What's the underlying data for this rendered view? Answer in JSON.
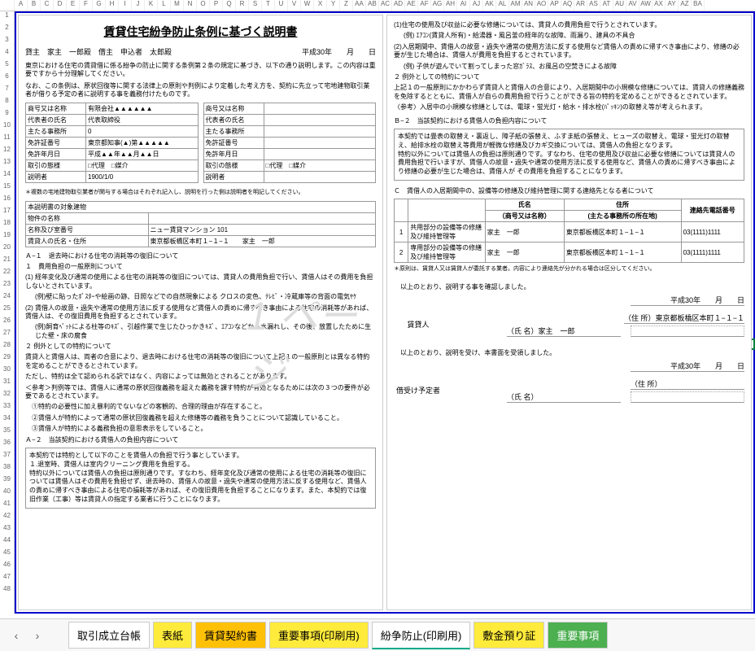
{
  "col_letters": [
    "A",
    "B",
    "C",
    "D",
    "E",
    "F",
    "G",
    "H",
    "I",
    "J",
    "K",
    "L",
    "M",
    "N",
    "O",
    "P",
    "Q",
    "R",
    "S",
    "T",
    "U",
    "V",
    "W",
    "X",
    "Y",
    "Z",
    "AA",
    "AB",
    "AC",
    "AD",
    "AE",
    "AF",
    "AG",
    "AH",
    "AI",
    "AJ",
    "AK",
    "AL",
    "AM",
    "AN",
    "AO",
    "AP",
    "AQ",
    "AR",
    "AS",
    "AT",
    "AU",
    "AV",
    "AW",
    "AX",
    "AY",
    "AZ",
    "BA"
  ],
  "title": "賃貸住宅紛争防止条例に基づく説明書",
  "header": {
    "lessor": "貸主　家主　一郎殿　借主　申込者　太郎殿",
    "date": "平成30年　　月　　日"
  },
  "intro": [
    "東京における住宅の賃貸借に係る紛争の防止に関する条例第２条の規定に基づき、以下の通り説明します。この内容は重要ですから十分理解してください。",
    "なお、この条例は、原状回復等に関する法律上の原則や判例により定着した考え方を、契約に先立って宅地建物取引業者が借りる予定の者に説明する事を義務付けたものです。"
  ],
  "reg_left": {
    "r1": {
      "l": "商号又は名称",
      "v": "有限会社▲▲▲▲▲▲"
    },
    "r2": {
      "l": "代表者の氏名",
      "v": "代表取締役"
    },
    "r3": {
      "l": "主たる事務所",
      "v": "0"
    },
    "r4": {
      "l": "免許証番号",
      "v": "東京都知事(▲)第▲▲▲▲▲"
    },
    "r5": {
      "l": "免許年月日",
      "v": "平成▲▲年▲▲月▲▲日"
    },
    "r6": {
      "l": "取引の態様",
      "v": "□代理　□媒介"
    },
    "r7": {
      "l": "説明者",
      "v": "1900/1/0"
    }
  },
  "reg_right": {
    "r1": {
      "l": "商号又は名称",
      "v": ""
    },
    "r2": {
      "l": "代表者の氏名",
      "v": ""
    },
    "r3": {
      "l": "主たる事務所",
      "v": ""
    },
    "r4": {
      "l": "免許証番号",
      "v": ""
    },
    "r5": {
      "l": "免許年月日",
      "v": ""
    },
    "r6": {
      "l": "取引の態様",
      "v": "□代理　□媒介"
    },
    "r7": {
      "l": "説明者",
      "v": ""
    }
  },
  "note1": "＊複数の宅地建物取引業者が関与する場合はそれぞれ記入し、説明を行った側は説明者を明記してください。",
  "prop": {
    "h": "本説明書の対象建物",
    "r1": {
      "l": "物件の名称",
      "v": ""
    },
    "r2": {
      "l": "名称及び室番号",
      "v": "ニュー賃貸マンション 101"
    },
    "r3": {
      "l": "賃貸人の氏名・住所",
      "v": "東京都板橋区本町１−１−１　　家主　一郎"
    }
  },
  "secA": {
    "h1": "Ａ−１　退去時における住宅の消耗等の復旧について",
    "h2": "１　費用負担の一般原則について",
    "p1": "(1) 経年変化及び通常の使用による住宅の消耗等の復旧については、賃貸人の費用負担で行い、賃借人はその費用を負担しないとされています。",
    "p2": "(例)壁に貼ったﾎﾟｽﾀｰや絵画の跡、日照などでの自然現象による クロスの変色、ﾃﾚﾋﾞ・冷蔵庫等の背面の電気ﾔｹ",
    "p3": "(2) 賃借人の故意・過失や通常の使用方法に反する使用など賃借人の責めに帰すべき事由による住宅の消耗等があれば、賃借人は、その復旧費用を負担するとされています。",
    "p4": "(例)飼育ﾍﾟｯﾄによる柱等のｷｽﾞ、引越作業で生じたひっかきｷｽﾞ、ｴｱｺﾝなどから水漏れし、その後、放置したために生じた壁・床の腐食",
    "h3": "２  例外としての特約について",
    "p5": "賃貸人と賃借人は、両者の合意により、退去時における住宅の消耗等の復旧について上記１の一般原則とは異なる特約を定めることができるとされています。",
    "p6": "ただし、特約は全て認められる訳ではなく、内容によっては無効とされることがあります。",
    "p7": "＜参考＞判例等では、賃借人に通常の原状回復義務を超えた義務を課す特約が有効となるためには次の３つの要件が必要であるとされています。",
    "p8": "①特約の必要性に加え暴利的でないなどの客観的、合理的理由が存在すること。",
    "p9": "②賃借人が特約によって通常の原状回復義務を超えた修繕等の義務を負うことについて認識していること。",
    "p10": "③賃借人が特約による義務負担の意思表示をしていること。",
    "h4": "Ａ−２　当該契約における賃借人の負担内容について"
  },
  "boxA": {
    "p1": "本契約では特約として以下のことを賃借人の負担で行う事としています。",
    "p2": "１.退室時、賃借人は室内クリーニング費用を負担する。",
    "p3": "特約以外については賃借人の負担は原則通りです。すなわち、経年変化及び通常の使用による住宅の消耗等の復旧については賃借人はその費用を負担せず、退去時の、賃借人の故意・過失や通常の使用方法に反する使用など、賃借人の責めに帰すべき事由による住宅の損耗等があれば、その復旧費用を負担することになります。また、本契約では復旧作業（工事）等は賃貸人の指定する業者に行うことになります。"
  },
  "secB": {
    "p1": "(1)住宅の使用及び収益に必要な修繕については、賃貸人の費用負担で行うとされています。",
    "p2": "(例) ｴｱｺﾝ(賃貸人所有)・給湯器・風呂釜の経年的な故障、雨漏り、建具の不具合",
    "p3": "(2)入居期間中、賃借人の故意・過失や通常の使用方法に反する使用など賃借人の責めに帰すべき事由により、修繕の必要が生じた場合は、賃借人が費用を負担するとされています。",
    "p4": "(例) 子供が遊んでいて割ってしまった窓ｶﾞﾗｽ、お風呂の空焚きによる故障",
    "h2": "２  例外としての特約について",
    "p5": "上記１の一般原則にかかわらず賃貸人と賃借人の合意により、入居期間中の小規模な修繕については、賃貸人の修繕義務を免除するとともに、賃借人が自らの費用負担で行うことができる旨の特約を定めることができるとされています。",
    "p6": "〈参考〉入居中の小規模な修繕としては、電球・蛍光灯・給水・排水栓(ﾊﾟｯｷﾝ)の取替え等が考えられます。",
    "h3": "Ｂ−２　当該契約における賃借人の負担内容について"
  },
  "boxB": {
    "p1": "本契約では畳表の取替え・裏返し、障子紙の張替え、ふすま紙の張替え、ヒューズの取替え、電球・蛍光灯の取替え、給排水栓の取替え等費用が軽微な修繕及びカギ交換については、賃借人の負担となります。",
    "p2": "特約以外については賃借人の負担は原則通りです。すなわち、住宅の使用及び収益に必要な修繕については賃貸人の費用負担で行いますが、賃借人の故意・過失や通常の使用方法に反する使用など、賃借人の責めに帰すべき事由により修繕の必要が生じた場合は、賃借人が その費用を負担することになります。"
  },
  "secC": {
    "h": "Ｃ　賃借人の入居期間中の、設備等の修繕及び維持管理に関する連絡先となる者について",
    "th1": "氏名",
    "th1b": "（商号又は名称）",
    "th2": "住所",
    "th2b": "(主たる事務所の所在地)",
    "th3": "連絡先電話番号",
    "row1": {
      "l": "共用部分の設備等の修繕及び維持管理等",
      "name": "家主　一郎",
      "addr": "東京都板橋区本町１−１−１",
      "tel": "03(1111)1111"
    },
    "row2": {
      "l": "専用部分の設備等の修繕及び維持管理等",
      "name": "家主　一郎",
      "addr": "東京都板橋区本町１−１−１",
      "tel": "03(1111)1111"
    },
    "note": "＊原則は、賃貸人又は賃貸人が委託する業者。内容により連絡先が分かれる場合は区分してください。"
  },
  "sig": {
    "c1": "以上のとおり、説明する事を確認しました。",
    "date1": "平成30年　　月　　日",
    "lessor_l": "賃貸人",
    "addr_l": "（住 所）東京都板橋区本町１−１−１",
    "name_l": "（氏 名）家主　一郎",
    "c2": "以上のとおり、説明を受け、本書面を受領しました。",
    "date2": "平成30年　　月　　日",
    "lessee_l": "借受け予定者",
    "addr2": "（住 所）",
    "name2": "（氏 名）"
  },
  "watermark": "1 ページ",
  "tabs": {
    "t1": "取引成立台帳",
    "t2": "表紙",
    "t3": "賃貸契約書",
    "t4": "重要事項(印刷用)",
    "t5": "紛争防止(印刷用)",
    "t6": "敷金預り証",
    "t7": "重要事項"
  }
}
